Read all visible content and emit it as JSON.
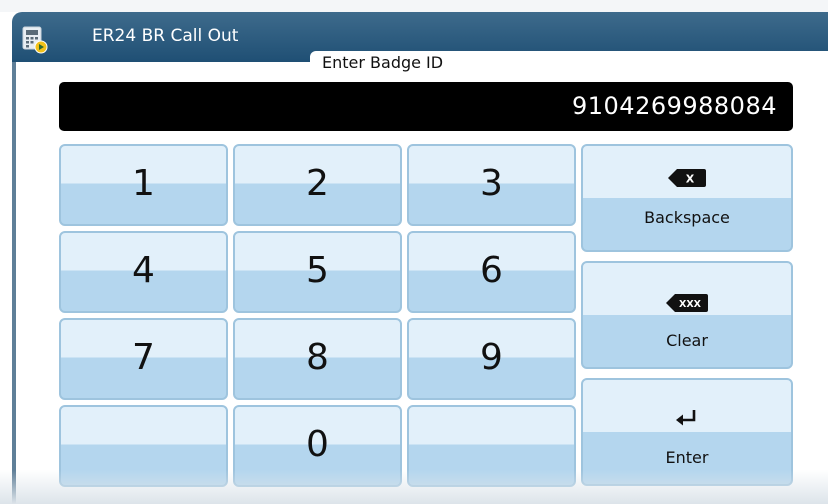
{
  "app": {
    "title": "ER24 BR Call Out",
    "icon": "calculator-play-icon"
  },
  "tab": {
    "label": "Enter Badge ID"
  },
  "display": {
    "value": "9104269988084"
  },
  "keypad": {
    "keys": [
      "1",
      "2",
      "3",
      "4",
      "5",
      "6",
      "7",
      "8",
      "9",
      "",
      "0",
      ""
    ]
  },
  "actions": {
    "backspace": {
      "label": "Backspace",
      "icon": "backspace-x-icon",
      "icon_text": "X"
    },
    "clear": {
      "label": "Clear",
      "icon": "clear-xxx-icon",
      "icon_text": "XXX"
    },
    "enter": {
      "label": "Enter",
      "icon": "enter-return-icon"
    }
  },
  "colors": {
    "title_bar": "#2c5b80",
    "key_top": "#e2f0fa",
    "key_bottom": "#b4d6ee",
    "key_border": "#9ec4de",
    "display_bg": "#000000"
  }
}
